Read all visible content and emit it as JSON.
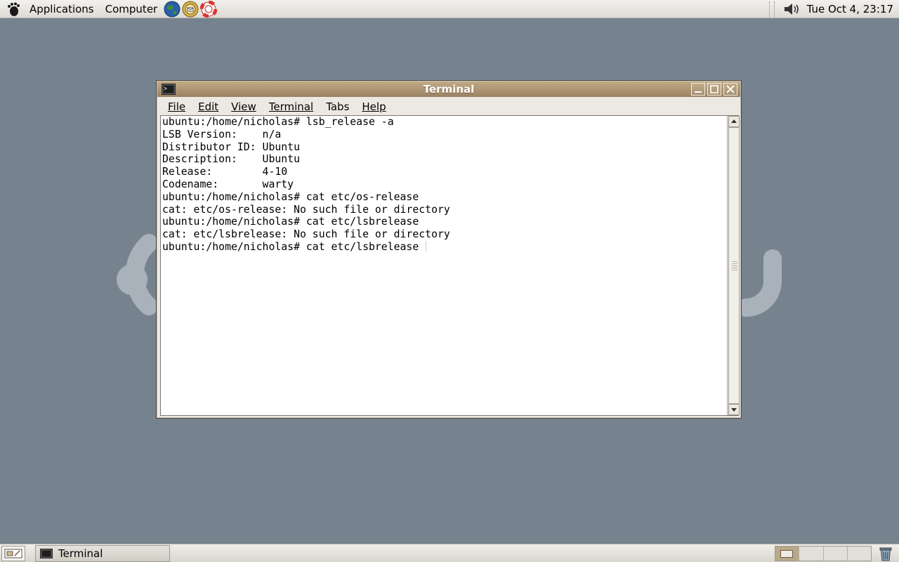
{
  "top_panel": {
    "applications_label": "Applications",
    "computer_label": "Computer",
    "launchers": [
      "web-browser-icon",
      "mail-icon",
      "help-icon"
    ],
    "clock": "Tue Oct  4, 23:17"
  },
  "window": {
    "title": "Terminal",
    "menu": [
      "File",
      "Edit",
      "View",
      "Terminal",
      "Tabs",
      "Help"
    ],
    "lines": [
      "ubuntu:/home/nicholas# lsb_release -a",
      "LSB Version:    n/a",
      "Distributor ID: Ubuntu",
      "Description:    Ubuntu",
      "Release:        4-10",
      "Codename:       warty",
      "ubuntu:/home/nicholas# cat etc/os-release",
      "cat: etc/os-release: No such file or directory",
      "ubuntu:/home/nicholas# cat etc/lsbrelease",
      "cat: etc/lsbrelease: No such file or directory",
      "ubuntu:/home/nicholas# cat etc/lsbrelease"
    ]
  },
  "bottom_panel": {
    "task_label": "Terminal",
    "workspaces": 4,
    "active_workspace": 1
  },
  "colors": {
    "desktop": "#76838f",
    "titlebar": "#b09878",
    "panel": "#e8e6e1"
  }
}
